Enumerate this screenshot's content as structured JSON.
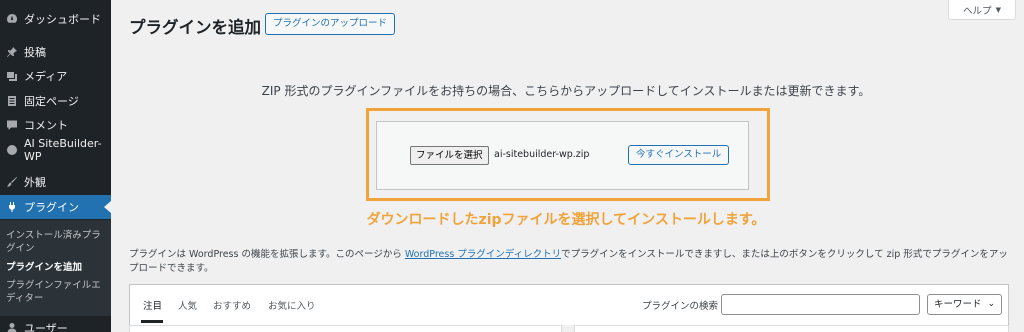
{
  "sidebar": {
    "items": [
      {
        "label": "ダッシュボード",
        "icon": "dashboard-icon"
      },
      {
        "label": "投稿",
        "icon": "pin-icon"
      },
      {
        "label": "メディア",
        "icon": "media-icon"
      },
      {
        "label": "固定ページ",
        "icon": "page-icon"
      },
      {
        "label": "コメント",
        "icon": "comment-icon"
      },
      {
        "label": "AI SiteBuilder-WP",
        "icon": "plugin-logo-icon"
      },
      {
        "label": "外観",
        "icon": "brush-icon"
      },
      {
        "label": "プラグイン",
        "icon": "plugin-icon"
      },
      {
        "label": "ユーザー",
        "icon": "user-icon"
      }
    ],
    "submenu": [
      {
        "label": "インストール済みプラグイン"
      },
      {
        "label": "プラグインを追加"
      },
      {
        "label": "プラグインファイルエディター"
      }
    ]
  },
  "header": {
    "title": "プラグインを追加",
    "upload_button": "プラグインのアップロード",
    "help_button": "ヘルプ",
    "help_caret": "▼"
  },
  "upload": {
    "description": "ZIP 形式のプラグインファイルをお持ちの場合、こちらからアップロードしてインストールまたは更新できます。",
    "file_button": "ファイルを選択",
    "file_name": "ai-sitebuilder-wp.zip",
    "install_button": "今すぐインストール",
    "annotation": "ダウンロードしたzipファイルを選択してインストールします。"
  },
  "intro": {
    "text_before": "プラグインは WordPress の機能を拡張します。このページから ",
    "link": "WordPress プラグインディレクトリ",
    "text_after": "でプラグインをインストールできますし、または上のボタンをクリックして zip 形式でプラグインをアップロードできます。"
  },
  "filter": {
    "tabs": [
      "注目",
      "人気",
      "おすすめ",
      "お気に入り"
    ],
    "search_label": "プラグインの検索",
    "search_value": "",
    "select_value": "キーワード"
  },
  "colors": {
    "sidebar_bg": "#1d2327",
    "accent": "#2271b1",
    "annotation": "#f0a33a"
  }
}
